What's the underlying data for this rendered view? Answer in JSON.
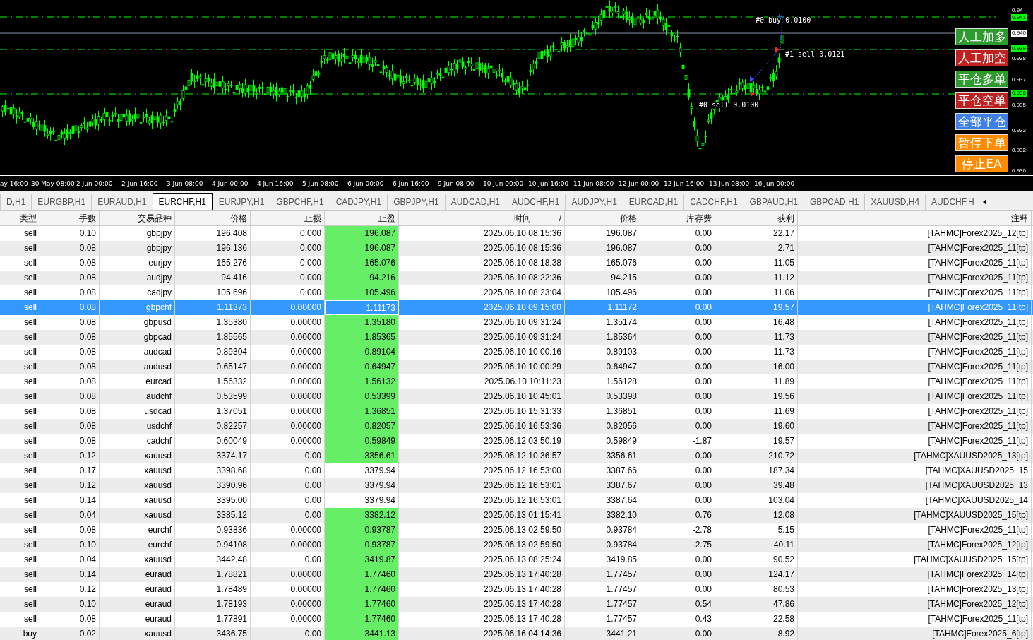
{
  "chart": {
    "trade_labels": [
      "#0 buy 0.0100",
      "#1 sell 0.0121",
      "#0 sell 0.0100"
    ],
    "price_labels": [
      {
        "text": "0.94",
        "kind": "plain"
      },
      {
        "text": "0.941",
        "kind": "green"
      },
      {
        "text": "0.940",
        "kind": "white"
      },
      {
        "text": "0.939",
        "kind": "green"
      },
      {
        "text": "0.938",
        "kind": "plain"
      },
      {
        "text": "0.937",
        "kind": "plain"
      },
      {
        "text": "0.936",
        "kind": "green"
      },
      {
        "text": "0.935",
        "kind": "plain"
      },
      {
        "text": "0.933",
        "kind": "plain"
      },
      {
        "text": "0.932",
        "kind": "plain"
      },
      {
        "text": "0.930",
        "kind": "plain"
      }
    ],
    "time_labels": [
      "ay 16:00",
      "30 May 08:00",
      "2 Jun 00:00",
      "2 Jun 16:00",
      "3 Jun 08:00",
      "4 Jun 00:00",
      "4 Jun 16:00",
      "5 Jun 08:00",
      "6 Jun 00:00",
      "6 Jun 16:00",
      "9 Jun 08:00",
      "10 Jun 00:00",
      "10 Jun 16:00",
      "11 Jun 08:00",
      "12 Jun 00:00",
      "12 Jun 16:00",
      "13 Jun 08:00",
      "16 Jun 00:00"
    ],
    "buttons": [
      {
        "label": "人工加多",
        "color": "#2e9b2e"
      },
      {
        "label": "人工加空",
        "color": "#c02020"
      },
      {
        "label": "平仓多单",
        "color": "#2e9b2e"
      },
      {
        "label": "平仓空单",
        "color": "#c02020"
      },
      {
        "label": "全部平仓",
        "color": "#3f7fe8"
      },
      {
        "label": "暂停下单",
        "color": "#ff8c00"
      },
      {
        "label": "停止EA",
        "color": "#ff8c00"
      }
    ]
  },
  "tabs": [
    {
      "label": "D,H1",
      "selected": false
    },
    {
      "label": "EURGBP,H1",
      "selected": false
    },
    {
      "label": "EURAUD,H1",
      "selected": false
    },
    {
      "label": "EURCHF,H1",
      "selected": true
    },
    {
      "label": "EURJPY,H1",
      "selected": false
    },
    {
      "label": "GBPCHF,H1",
      "selected": false
    },
    {
      "label": "CADJPY,H1",
      "selected": false
    },
    {
      "label": "GBPJPY,H1",
      "selected": false
    },
    {
      "label": "AUDCAD,H1",
      "selected": false
    },
    {
      "label": "AUDCHF,H1",
      "selected": false
    },
    {
      "label": "AUDJPY,H1",
      "selected": false
    },
    {
      "label": "EURCAD,H1",
      "selected": false
    },
    {
      "label": "CADCHF,H1",
      "selected": false
    },
    {
      "label": "GBPAUD,H1",
      "selected": false
    },
    {
      "label": "GBPCAD,H1",
      "selected": false
    },
    {
      "label": "XAUUSD,H4",
      "selected": false
    },
    {
      "label": "AUDCHF,H",
      "selected": false
    }
  ],
  "table": {
    "columns": [
      {
        "label": "类型"
      },
      {
        "label": "手数"
      },
      {
        "label": "交易品种"
      },
      {
        "label": "价格"
      },
      {
        "label": "止损"
      },
      {
        "label": "止盈"
      },
      {
        "label": "时间",
        "sort_mark": "/"
      },
      {
        "label": "价格"
      },
      {
        "label": "库存费"
      },
      {
        "label": "获利"
      },
      {
        "label": "注释"
      }
    ],
    "rows": [
      {
        "selected": false,
        "tp_reached": true,
        "cells": [
          "sell",
          "0.10",
          "gbpjpy",
          "196.408",
          "0.000",
          "196.087",
          "2025.06.10 08:15:36",
          "196.087",
          "0.00",
          "22.17",
          "[TAHMC]Forex2025_12[tp]"
        ]
      },
      {
        "selected": false,
        "tp_reached": true,
        "cells": [
          "sell",
          "0.08",
          "gbpjpy",
          "196.136",
          "0.000",
          "196.087",
          "2025.06.10 08:15:36",
          "196.087",
          "0.00",
          "2.71",
          "[TAHMC]Forex2025_11[tp]"
        ]
      },
      {
        "selected": false,
        "tp_reached": true,
        "cells": [
          "sell",
          "0.08",
          "eurjpy",
          "165.276",
          "0.000",
          "165.076",
          "2025.06.10 08:18:38",
          "165.076",
          "0.00",
          "11.05",
          "[TAHMC]Forex2025_11[tp]"
        ]
      },
      {
        "selected": false,
        "tp_reached": true,
        "cells": [
          "sell",
          "0.08",
          "audjpy",
          "94.416",
          "0.000",
          "94.216",
          "2025.06.10 08:22:36",
          "94.215",
          "0.00",
          "11.12",
          "[TAHMC]Forex2025_11[tp]"
        ]
      },
      {
        "selected": false,
        "tp_reached": true,
        "cells": [
          "sell",
          "0.08",
          "cadjpy",
          "105.696",
          "0.000",
          "105.496",
          "2025.06.10 08:23:04",
          "105.496",
          "0.00",
          "11.06",
          "[TAHMC]Forex2025_11[tp]"
        ]
      },
      {
        "selected": true,
        "tp_reached": true,
        "cells": [
          "sell",
          "0.08",
          "gbpchf",
          "1.11373",
          "0.00000",
          "1.11173",
          "2025.06.10 09:15:00",
          "1.11172",
          "0.00",
          "19.57",
          "[TAHMC]Forex2025_11[tp]"
        ]
      },
      {
        "selected": false,
        "tp_reached": true,
        "cells": [
          "sell",
          "0.08",
          "gbpusd",
          "1.35380",
          "0.00000",
          "1.35180",
          "2025.06.10 09:31:24",
          "1.35174",
          "0.00",
          "16.48",
          "[TAHMC]Forex2025_11[tp]"
        ]
      },
      {
        "selected": false,
        "tp_reached": true,
        "cells": [
          "sell",
          "0.08",
          "gbpcad",
          "1.85565",
          "0.00000",
          "1.85365",
          "2025.06.10 09:31:24",
          "1.85364",
          "0.00",
          "11.73",
          "[TAHMC]Forex2025_11[tp]"
        ]
      },
      {
        "selected": false,
        "tp_reached": true,
        "cells": [
          "sell",
          "0.08",
          "audcad",
          "0.89304",
          "0.00000",
          "0.89104",
          "2025.06.10 10:00:16",
          "0.89103",
          "0.00",
          "11.73",
          "[TAHMC]Forex2025_11[tp]"
        ]
      },
      {
        "selected": false,
        "tp_reached": true,
        "cells": [
          "sell",
          "0.08",
          "audusd",
          "0.65147",
          "0.00000",
          "0.64947",
          "2025.06.10 10:00:29",
          "0.64947",
          "0.00",
          "16.00",
          "[TAHMC]Forex2025_11[tp]"
        ]
      },
      {
        "selected": false,
        "tp_reached": true,
        "cells": [
          "sell",
          "0.08",
          "eurcad",
          "1.56332",
          "0.00000",
          "1.56132",
          "2025.06.10 10:11:23",
          "1.56128",
          "0.00",
          "11.89",
          "[TAHMC]Forex2025_11[tp]"
        ]
      },
      {
        "selected": false,
        "tp_reached": true,
        "cells": [
          "sell",
          "0.08",
          "audchf",
          "0.53599",
          "0.00000",
          "0.53399",
          "2025.06.10 10:45:01",
          "0.53398",
          "0.00",
          "19.56",
          "[TAHMC]Forex2025_11[tp]"
        ]
      },
      {
        "selected": false,
        "tp_reached": true,
        "cells": [
          "sell",
          "0.08",
          "usdcad",
          "1.37051",
          "0.00000",
          "1.36851",
          "2025.06.10 15:31:33",
          "1.36851",
          "0.00",
          "11.69",
          "[TAHMC]Forex2025_11[tp]"
        ]
      },
      {
        "selected": false,
        "tp_reached": true,
        "cells": [
          "sell",
          "0.08",
          "usdchf",
          "0.82257",
          "0.00000",
          "0.82057",
          "2025.06.10 16:53:36",
          "0.82056",
          "0.00",
          "19.60",
          "[TAHMC]Forex2025_11[tp]"
        ]
      },
      {
        "selected": false,
        "tp_reached": true,
        "cells": [
          "sell",
          "0.08",
          "cadchf",
          "0.60049",
          "0.00000",
          "0.59849",
          "2025.06.12 03:50:19",
          "0.59849",
          "-1.87",
          "19.57",
          "[TAHMC]Forex2025_11[tp]"
        ]
      },
      {
        "selected": false,
        "tp_reached": true,
        "cells": [
          "sell",
          "0.12",
          "xauusd",
          "3374.17",
          "0.00",
          "3356.61",
          "2025.06.12 10:36:57",
          "3356.61",
          "0.00",
          "210.72",
          "[TAHMC]XAUUSD2025_13[tp]"
        ]
      },
      {
        "selected": false,
        "tp_reached": false,
        "cells": [
          "sell",
          "0.17",
          "xauusd",
          "3398.68",
          "0.00",
          "3379.94",
          "2025.06.12 16:53:00",
          "3387.66",
          "0.00",
          "187.34",
          "[TAHMC]XAUUSD2025_15"
        ]
      },
      {
        "selected": false,
        "tp_reached": false,
        "cells": [
          "sell",
          "0.12",
          "xauusd",
          "3390.96",
          "0.00",
          "3379.94",
          "2025.06.12 16:53:01",
          "3387.67",
          "0.00",
          "39.48",
          "[TAHMC]XAUUSD2025_13"
        ]
      },
      {
        "selected": false,
        "tp_reached": false,
        "cells": [
          "sell",
          "0.14",
          "xauusd",
          "3395.00",
          "0.00",
          "3379.94",
          "2025.06.12 16:53:01",
          "3387.64",
          "0.00",
          "103.04",
          "[TAHMC]XAUUSD2025_14"
        ]
      },
      {
        "selected": false,
        "tp_reached": true,
        "cells": [
          "sell",
          "0.04",
          "xauusd",
          "3385.12",
          "0.00",
          "3382.12",
          "2025.06.13 01:15:41",
          "3382.10",
          "0.76",
          "12.08",
          "[TAHMC]XAUUSD2025_15[tp]"
        ]
      },
      {
        "selected": false,
        "tp_reached": true,
        "cells": [
          "sell",
          "0.08",
          "eurchf",
          "0.93836",
          "0.00000",
          "0.93787",
          "2025.06.13 02:59:50",
          "0.93784",
          "-2.78",
          "5.15",
          "[TAHMC]Forex2025_11[tp]"
        ]
      },
      {
        "selected": false,
        "tp_reached": true,
        "cells": [
          "sell",
          "0.10",
          "eurchf",
          "0.94108",
          "0.00000",
          "0.93787",
          "2025.06.13 02:59:50",
          "0.93784",
          "-2.75",
          "40.11",
          "[TAHMC]Forex2025_12[tp]"
        ]
      },
      {
        "selected": false,
        "tp_reached": true,
        "cells": [
          "sell",
          "0.04",
          "xauusd",
          "3442.48",
          "0.00",
          "3419.87",
          "2025.06.13 08:25:24",
          "3419.85",
          "0.00",
          "90.52",
          "[TAHMC]XAUUSD2025_15[tp]"
        ]
      },
      {
        "selected": false,
        "tp_reached": true,
        "cells": [
          "sell",
          "0.14",
          "euraud",
          "1.78821",
          "0.00000",
          "1.77460",
          "2025.06.13 17:40:28",
          "1.77457",
          "0.00",
          "124.17",
          "[TAHMC]Forex2025_14[tp]"
        ]
      },
      {
        "selected": false,
        "tp_reached": true,
        "cells": [
          "sell",
          "0.12",
          "euraud",
          "1.78489",
          "0.00000",
          "1.77460",
          "2025.06.13 17:40:28",
          "1.77457",
          "0.00",
          "80.53",
          "[TAHMC]Forex2025_13[tp]"
        ]
      },
      {
        "selected": false,
        "tp_reached": true,
        "cells": [
          "sell",
          "0.10",
          "euraud",
          "1.78193",
          "0.00000",
          "1.77460",
          "2025.06.13 17:40:28",
          "1.77457",
          "0.54",
          "47.86",
          "[TAHMC]Forex2025_12[tp]"
        ]
      },
      {
        "selected": false,
        "tp_reached": true,
        "cells": [
          "sell",
          "0.08",
          "euraud",
          "1.77891",
          "0.00000",
          "1.77460",
          "2025.06.13 17:40:28",
          "1.77457",
          "0.43",
          "22.58",
          "[TAHMC]Forex2025_11[tp]"
        ]
      },
      {
        "selected": false,
        "tp_reached": true,
        "cells": [
          "buy",
          "0.02",
          "xauusd",
          "3436.75",
          "0.00",
          "3441.13",
          "2025.06.16 04:14:36",
          "3441.21",
          "0.00",
          "8.92",
          "[TAHMC]Forex2025_6[tp]"
        ]
      }
    ]
  }
}
